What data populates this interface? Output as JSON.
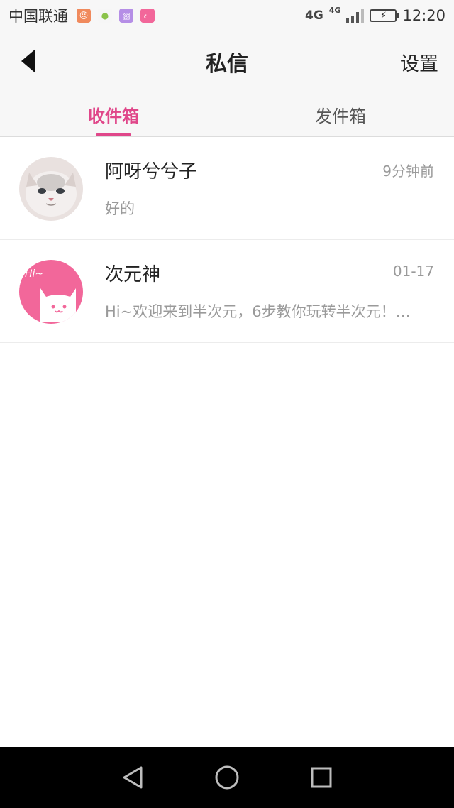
{
  "status_bar": {
    "carrier": "中国联通",
    "network": "4G",
    "network_small": "4G",
    "time": "12:20"
  },
  "header": {
    "title": "私信",
    "settings_label": "设置"
  },
  "tabs": [
    {
      "label": "收件箱",
      "active": true
    },
    {
      "label": "发件箱",
      "active": false
    }
  ],
  "messages": [
    {
      "sender": "阿呀兮兮子",
      "time": "9分钟前",
      "preview": "好的",
      "avatar": "cat-photo-avatar"
    },
    {
      "sender": "次元神",
      "time": "01-17",
      "preview": "Hi~欢迎来到半次元，6步教你玩转半次元！…",
      "avatar": "pink-cat-avatar"
    }
  ],
  "colors": {
    "accent": "#e0478a",
    "avatar_pink": "#f2679a"
  },
  "nav": [
    "back-triangle-icon",
    "home-circle-icon",
    "recents-square-icon"
  ]
}
